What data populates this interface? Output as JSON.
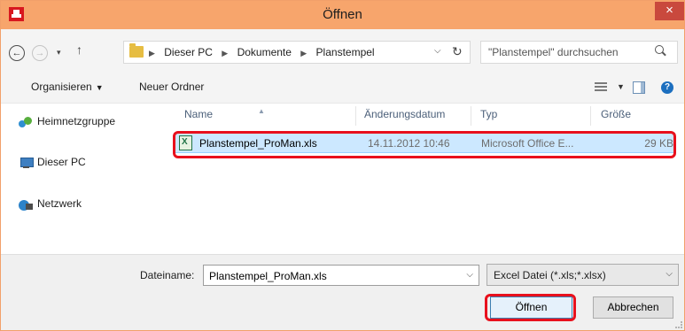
{
  "window": {
    "title": "Öffnen",
    "close_symbol": "×",
    "app_icon": "app-logo-icon"
  },
  "nav": {
    "back_symbol": "←",
    "forward_symbol": "→",
    "recent_symbol": "▾",
    "up_symbol": "↑",
    "breadcrumbs": [
      "Dieser PC",
      "Dokumente",
      "Planstempel"
    ],
    "crumb_separator": "▶",
    "address_dropdown": "⌵",
    "refresh_symbol": "↻",
    "search_placeholder": "\"Planstempel\" durchsuchen"
  },
  "toolbar": {
    "organize_label": "Organisieren",
    "organize_caret": "▼",
    "new_folder_label": "Neuer Ordner",
    "view_caret": "▼",
    "help_symbol": "?"
  },
  "sidebar": {
    "items": [
      {
        "label": "Heimnetzgruppe",
        "icon": "homegroup-icon"
      },
      {
        "label": "Dieser PC",
        "icon": "computer-icon"
      },
      {
        "label": "Netzwerk",
        "icon": "network-icon"
      }
    ]
  },
  "filelist": {
    "columns": [
      "Name",
      "Änderungsdatum",
      "Typ",
      "Größe"
    ],
    "sort_caret": "▲",
    "files": [
      {
        "name": "Planstempel_ProMan.xls",
        "modified": "14.11.2012 10:46",
        "type": "Microsoft Office E...",
        "size": "29 KB",
        "icon": "excel-file-icon"
      }
    ]
  },
  "footer": {
    "filename_label": "Dateiname:",
    "filename_value": "Planstempel_ProMan.xls",
    "filename_dropdown": "⌵",
    "filetype_value": "Excel Datei (*.xls;*.xlsx)",
    "filetype_dropdown": "⌵",
    "open_label": "Öffnen",
    "cancel_label": "Abbrechen"
  },
  "colors": {
    "titlebar": "#f7a56c",
    "close_button": "#c9493d",
    "selection": "#cce8ff",
    "highlight": "#e8101c"
  }
}
